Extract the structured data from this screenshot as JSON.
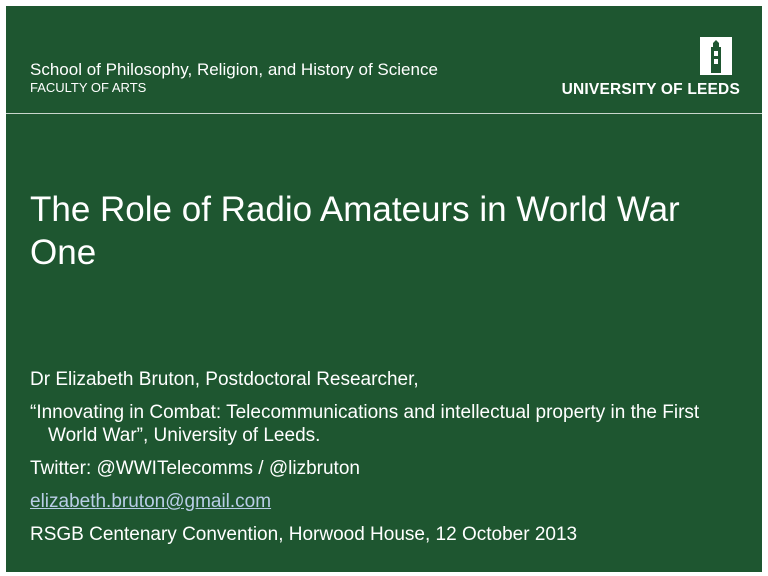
{
  "header": {
    "department": "School of Philosophy, Religion, and History of Science",
    "faculty": "FACULTY OF ARTS",
    "logo_text": "UNIVERSITY OF LEEDS",
    "logo_icon": "parkinson-tower-icon"
  },
  "title": "The Role of Radio Amateurs in World War One",
  "body": {
    "author": "Dr Elizabeth Bruton, Postdoctoral Researcher,",
    "project": "“Innovating in Combat: Telecommunications and intellectual property in the First World War”, University of Leeds.",
    "twitter": "Twitter: @WWITelecomms / @lizbruton",
    "email": "elizabeth.bruton@gmail.com",
    "event": "RSGB Centenary Convention, Horwood House, 12 October 2013"
  },
  "colors": {
    "background": "#1e5630",
    "text": "#ffffff",
    "link": "#b9cde6"
  }
}
